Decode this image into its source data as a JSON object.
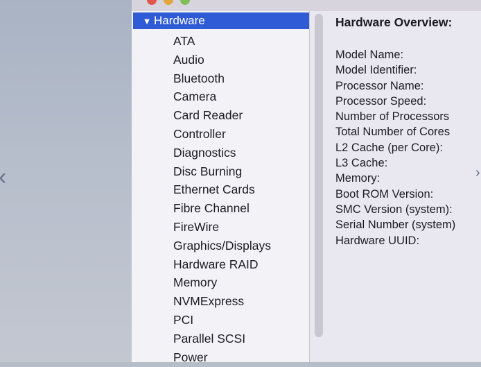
{
  "window": {
    "traffic_lights": {
      "close": "#e0564a",
      "minimize": "#e2a73a",
      "zoom": "#7fbf5a"
    }
  },
  "sidebar": {
    "section": {
      "label": "Hardware",
      "expanded_glyph": "▼"
    },
    "items": [
      "ATA",
      "Audio",
      "Bluetooth",
      "Camera",
      "Card Reader",
      "Controller",
      "Diagnostics",
      "Disc Burning",
      "Ethernet Cards",
      "Fibre Channel",
      "FireWire",
      "Graphics/Displays",
      "Hardware RAID",
      "Memory",
      "NVMExpress",
      "PCI",
      "Parallel SCSI",
      "Power"
    ]
  },
  "detail": {
    "title": "Hardware Overview:",
    "fields": [
      "Model Name:",
      "Model Identifier:",
      "Processor Name:",
      "Processor Speed:",
      "Number of Processors",
      "Total Number of Cores",
      "L2 Cache (per Core):",
      "L3 Cache:",
      "Memory:",
      "Boot ROM Version:",
      "SMC Version (system):",
      "Serial Number (system)",
      "Hardware UUID:"
    ]
  },
  "colors": {
    "selection": "#2f5bd6",
    "sidebar_bg": "#f3f2f7"
  }
}
